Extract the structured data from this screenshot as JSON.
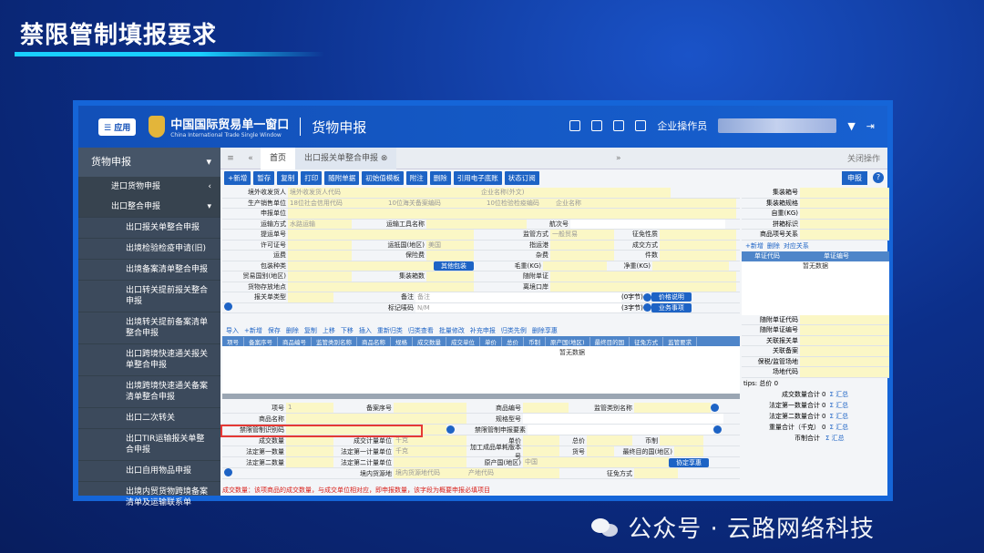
{
  "slide": {
    "title": "禁限管制填报要求",
    "watermark": "公众号 · 云路网络科技"
  },
  "topbar": {
    "menu_label": "☰ 应用",
    "logo_cn": "中国国际贸易单一窗口",
    "logo_en": "China International Trade Single Window",
    "module": "货物申报",
    "user_role": "企业操作员",
    "icons": [
      "message-icon",
      "mail-icon",
      "service-icon",
      "mobile-icon",
      "logout-icon"
    ]
  },
  "sidebar": {
    "main": "货物申报",
    "subs": [
      "进口货物申报",
      "出口整合申报"
    ],
    "items": [
      "出口报关单整合申报",
      "出境检验检疫申请(旧)",
      "出境备案清单整合申报",
      "出口转关提前报关整合申报",
      "出境转关提前备案清单整合申报",
      "出口跨境快速通关报关单整合申报",
      "出境跨境快速通关备案清单整合申报",
      "出口二次转关",
      "出口TIR运输报关单整合申报",
      "出口自用物品申报",
      "出境内贸货物跨境备案清单及运输联系单"
    ]
  },
  "tabs": {
    "home": "首页",
    "current": "出口报关单整合申报 ⊗",
    "close_ops": "关闭操作"
  },
  "toolbar": [
    "+新增",
    "暂存",
    "复制",
    "打印",
    "随附单据",
    "初始值模板",
    "附注",
    "删除",
    "引用电子底账",
    "状态订阅"
  ],
  "declare_btn": "申报",
  "form": {
    "r1": {
      "l": "境外收发货人",
      "v": "境外收发货人代码",
      "v2": "企业名称(外文)"
    },
    "r2": {
      "l": "生产销售单位",
      "v": "18位社会信用代码",
      "v2": "10位海关备案编码",
      "v3": "10位检验检疫编码",
      "v4": "企业名称"
    },
    "r3": {
      "l": "申报单位"
    },
    "r4": {
      "l1": "运输方式",
      "v1": "水路运输",
      "l2": "运输工具名称",
      "l3": "航次号"
    },
    "r5": {
      "l1": "提运单号",
      "l2": "监管方式",
      "v2": "一般贸易",
      "l3": "征免性质"
    },
    "r6": {
      "l1": "许可证号",
      "l2": "运抵国(地区)",
      "v2": "美国",
      "l3": "指运港",
      "l4": "成交方式"
    },
    "r7": {
      "l1": "运费",
      "l2": "保险费",
      "l3": "杂费",
      "l4": "件数"
    },
    "r8": {
      "l1": "包装种类",
      "btn": "其他包装",
      "l3": "毛重(KG)",
      "l4": "净重(KG)"
    },
    "r9": {
      "l1": "贸易国别(地区)",
      "l2": "集装箱数",
      "l3": "随附单证"
    },
    "r10": {
      "l1": "货物存放地点",
      "l3": "离境口岸"
    },
    "r11": {
      "l1": "报关单类型",
      "l2": "备注",
      "v2": "备注",
      "count": "(0字节)",
      "btn": "价格说明"
    },
    "r12": {
      "l2": "标记唛码",
      "v2": "N/M",
      "count": "(3字节)",
      "btn": "业务事项"
    }
  },
  "right": {
    "rows": [
      "集装箱号",
      "集装箱规格",
      "自重(KG)",
      "拼箱标识",
      "商品项号关系"
    ],
    "tb": [
      "+新增",
      "删除",
      "对应关系"
    ],
    "th": [
      "单证代码",
      "单证编号"
    ],
    "empty": "暂无数据",
    "rows2": [
      "随附单证代码",
      "随附单证编号",
      "关联报关单",
      "关联备案",
      "保税/监管场地",
      "场地代码"
    ],
    "tips": "tips: 总价 0",
    "sums": [
      {
        "l": "成交数量合计",
        "v": "0",
        "b": "Σ 汇总"
      },
      {
        "l": "法定第一数量合计",
        "v": "0",
        "b": "Σ 汇总"
      },
      {
        "l": "法定第二数量合计",
        "v": "0",
        "b": "Σ 汇总"
      },
      {
        "l": "重量合计（千克）",
        "v": "0",
        "b": "Σ 汇总"
      },
      {
        "l": "币制合计",
        "v": "",
        "b": "Σ 汇总"
      }
    ]
  },
  "grid": {
    "toolbar": [
      "导入",
      "+新增",
      "保存",
      "删除",
      "复制",
      "上移",
      "下移",
      "插入",
      "重新归类",
      "归类查看",
      "批量修改",
      "补充申报",
      "归类先例",
      "删除享惠"
    ],
    "headers": [
      "项号",
      "备案序号",
      "商品编号",
      "监管类别名称",
      "商品名称",
      "规格",
      "成交数量",
      "成交单位",
      "单价",
      "总价",
      "币制",
      "原产国(地区)",
      "最终目的国",
      "征免方式",
      "监管要求"
    ],
    "empty": "暂无数据"
  },
  "detail": {
    "r1": {
      "l1": "项号",
      "v1": "1",
      "l2": "备案序号",
      "l3": "商品编号",
      "l4": "监管类别名称"
    },
    "r2": {
      "l1": "商品名称",
      "l3": "规格型号"
    },
    "r3": {
      "l1": "禁限管制识别码",
      "l3": "禁限管制申报要素"
    },
    "r4": {
      "l1": "成交数量",
      "l2": "成交计量单位",
      "v2": "千克",
      "l3": "单价",
      "l4": "总价",
      "l5": "币制"
    },
    "r5": {
      "l1": "法定第一数量",
      "l2": "法定第一计量单位",
      "v2": "千克",
      "l3": "加工成品单耗版本号",
      "l4": "货号",
      "l5": "最终目的国(地区)"
    },
    "r6": {
      "l1": "法定第二数量",
      "l2": "法定第二计量单位",
      "l3": "原产国(地区)",
      "v3": "中国",
      "btn": "协定享惠"
    },
    "r7": {
      "l2": "境内货源地",
      "v2": "境内货源地代码",
      "v3": "产地代码",
      "l4": "征免方式"
    }
  },
  "warning": "成交数量：该项商品的成交数量，与成交单位相对应，即申报数量，该字段为概要申报必填项目"
}
